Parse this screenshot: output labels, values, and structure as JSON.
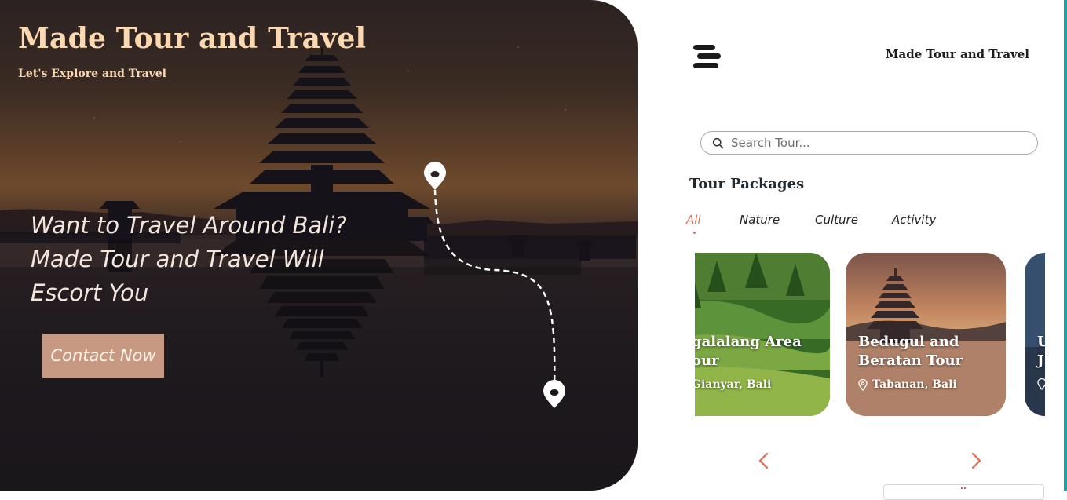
{
  "hero": {
    "title": "Made Tour and Travel",
    "subtitle": "Let's Explore and Travel",
    "heading_line1": "Want to Travel Around Bali?",
    "heading_line2": "Made Tour and Travel Will Escort You",
    "cta_label": "Contact Now"
  },
  "header": {
    "menu_icon": "hamburger-menu-icon",
    "brand": "Made Tour and Travel"
  },
  "search": {
    "placeholder": "Search Tour...",
    "value": ""
  },
  "packages": {
    "title": "Tour Packages",
    "tabs": [
      {
        "label": "All",
        "active": true
      },
      {
        "label": "Nature",
        "active": false
      },
      {
        "label": "Culture",
        "active": false
      },
      {
        "label": "Activity",
        "active": false
      }
    ],
    "cards": [
      {
        "title": "Tegalalang Area Tour",
        "location": "Gianyar, Bali",
        "visible_title": "galalang Area\nour",
        "visible_location": "Gianyar, Bali"
      },
      {
        "title": "Bedugul and Beratan Tour",
        "location": "Tabanan, Bali"
      },
      {
        "title": "U J",
        "location": ""
      }
    ],
    "prev_icon": "chevron-left-icon",
    "next_icon": "chevron-right-icon"
  },
  "colors": {
    "accent": "#d9735e",
    "hero_text": "#fcd8b0",
    "cta_bg": "#c79983",
    "edge": "#1fa3a8"
  }
}
